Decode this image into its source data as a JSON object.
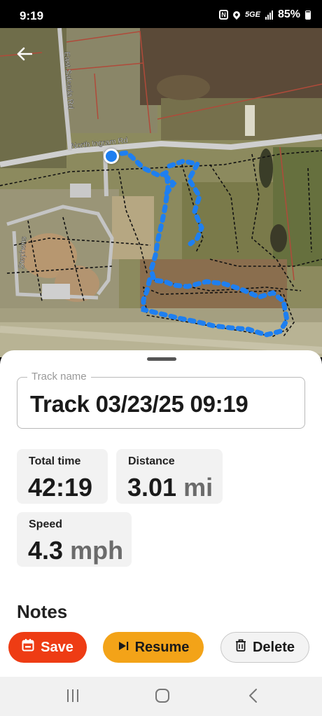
{
  "status_bar": {
    "time": "9:19",
    "nfc_label": "N",
    "network": "5G",
    "network_suffix": "E",
    "battery": "85%"
  },
  "map": {
    "labels": {
      "east_salceda": "East Salceda Rd",
      "north_ingram": "North Ingram Rd",
      "stephens": "Stephens"
    },
    "icons": [
      "back-arrow-icon",
      "current-location-icon"
    ]
  },
  "track": {
    "name_label": "Track name",
    "name_value": "Track 03/23/25 09:19"
  },
  "stats": {
    "total_time": {
      "label": "Total time",
      "value": "42:19",
      "unit": ""
    },
    "distance": {
      "label": "Distance",
      "value": "3.01",
      "unit": "mi"
    },
    "speed": {
      "label": "Speed",
      "value": "4.3",
      "unit": "mph"
    }
  },
  "notes": {
    "heading": "Notes"
  },
  "actions": {
    "save": {
      "label": "Save",
      "icon": "calendar-save-icon",
      "color": "#ee3c14"
    },
    "resume": {
      "label": "Resume",
      "icon": "resume-play-icon",
      "color": "#f3a318"
    },
    "delete": {
      "label": "Delete",
      "icon": "trash-icon"
    }
  },
  "colors": {
    "track_line": "#1e7ff0",
    "save": "#ee3c14",
    "resume": "#f3a318"
  }
}
